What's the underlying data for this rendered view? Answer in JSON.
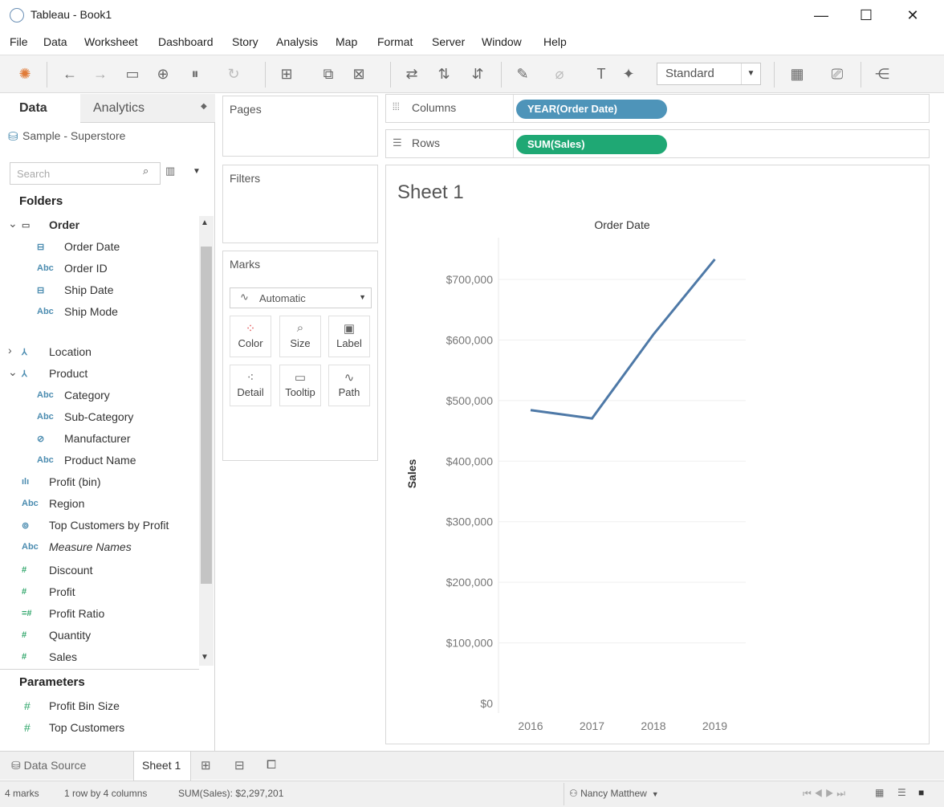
{
  "window": {
    "title": "Tableau - Book1",
    "minimize": "—",
    "maximize": "☐",
    "close": "✕"
  },
  "menu": [
    "File",
    "Data",
    "Worksheet",
    "Dashboard",
    "Story",
    "Analysis",
    "Map",
    "Format",
    "Server",
    "Window",
    "Help"
  ],
  "toolbar": {
    "fit_select": "Standard"
  },
  "left": {
    "tab_data": "Data",
    "tab_analytics": "Analytics",
    "datasource": "Sample - Superstore",
    "search_placeholder": "Search",
    "folders_label": "Folders",
    "parameters_label": "Parameters"
  },
  "tree": [
    {
      "label": "Order",
      "type": "folder"
    },
    {
      "label": "Order Date",
      "type": "date"
    },
    {
      "label": "Order ID",
      "type": "abc"
    },
    {
      "label": "Ship Date",
      "type": "date"
    },
    {
      "label": "Ship Mode",
      "type": "abc"
    },
    {
      "label": "Location",
      "type": "hier"
    },
    {
      "label": "Product",
      "type": "hier"
    },
    {
      "label": "Category",
      "type": "abc"
    },
    {
      "label": "Sub-Category",
      "type": "abc"
    },
    {
      "label": "Manufacturer",
      "type": "link"
    },
    {
      "label": "Product Name",
      "type": "abc"
    },
    {
      "label": "Profit (bin)",
      "type": "bin"
    },
    {
      "label": "Region",
      "type": "abc"
    },
    {
      "label": "Top Customers by Profit",
      "type": "set"
    },
    {
      "label": "Measure Names",
      "type": "abc"
    },
    {
      "label": "Discount",
      "type": "num"
    },
    {
      "label": "Profit",
      "type": "num"
    },
    {
      "label": "Profit Ratio",
      "type": "calc"
    },
    {
      "label": "Quantity",
      "type": "num"
    },
    {
      "label": "Sales",
      "type": "num"
    }
  ],
  "parameters": [
    "Profit Bin Size",
    "Top Customers"
  ],
  "cards": {
    "pages": "Pages",
    "filters": "Filters",
    "marks": "Marks",
    "mark_type": "Automatic",
    "buttons": [
      "Color",
      "Size",
      "Label",
      "Detail",
      "Tooltip",
      "Path"
    ]
  },
  "shelves": {
    "columns_label": "Columns",
    "columns_pill": "YEAR(Order Date)",
    "rows_label": "Rows",
    "rows_pill": "SUM(Sales)",
    "columns_color": "#4e94b9",
    "rows_color": "#1fa874"
  },
  "sheet": {
    "title": "Sheet 1"
  },
  "chart_data": {
    "type": "line",
    "title": "Order Date",
    "xlabel": "",
    "ylabel": "Sales",
    "categories": [
      "2016",
      "2017",
      "2018",
      "2019"
    ],
    "series": [
      {
        "values": [
          484247,
          470533,
          609206,
          733215
        ]
      }
    ],
    "ylim": [
      0,
      700000
    ],
    "yticks": [
      "$0",
      "$100,000",
      "$200,000",
      "$300,000",
      "$400,000",
      "$500,000",
      "$600,000",
      "$700,000"
    ],
    "line_color": "#4e79a7",
    "grid": true
  },
  "bottom_tabs": {
    "data_source": "Data Source",
    "sheet": "Sheet 1"
  },
  "status": {
    "marks": "4 marks",
    "dims": "1 row by 4 columns",
    "sum": "SUM(Sales): $2,297,201",
    "user": "Nancy Matthew"
  }
}
